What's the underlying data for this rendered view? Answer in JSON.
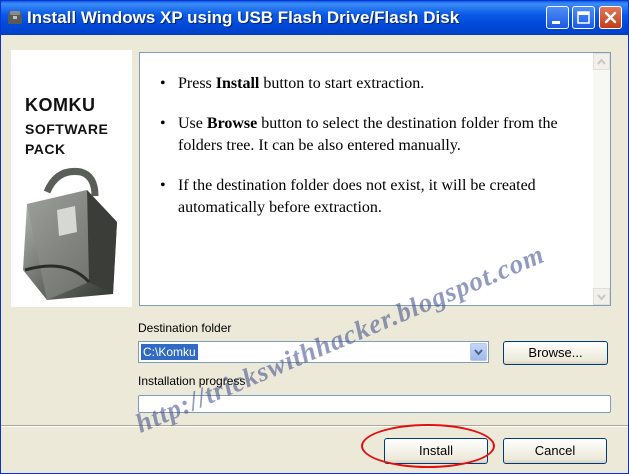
{
  "window": {
    "title": "Install Windows XP using USB Flash Drive/Flash Disk",
    "controls": {
      "minimize": "minimize-icon",
      "maximize": "maximize-icon",
      "close": "close-icon"
    }
  },
  "logo": {
    "line1": "KOMKU",
    "line2": "SOFTWARE",
    "line3": "PACK"
  },
  "info": {
    "items": [
      {
        "pre": "Press ",
        "bold": "Install",
        "post": " button to start extraction."
      },
      {
        "pre": "Use ",
        "bold": "Browse",
        "post": " button to select the destination folder from the folders tree. It can be also entered manually."
      },
      {
        "pre": "If the destination folder does not exist, it will be created automatically before extraction.",
        "bold": "",
        "post": ""
      }
    ]
  },
  "destination": {
    "label": "Destination folder",
    "value": "C:\\Komku"
  },
  "browse_label": "Browse...",
  "progress": {
    "label": "Installation progress",
    "value": 0
  },
  "install_label": "Install",
  "cancel_label": "Cancel",
  "watermark": "http://trickswithhacker.blogspot.com",
  "colors": {
    "titlebar": "#0a5ae6",
    "dialog": "#ece9d8",
    "highlight_oval": "#e01010",
    "selection": "#316ac5"
  }
}
